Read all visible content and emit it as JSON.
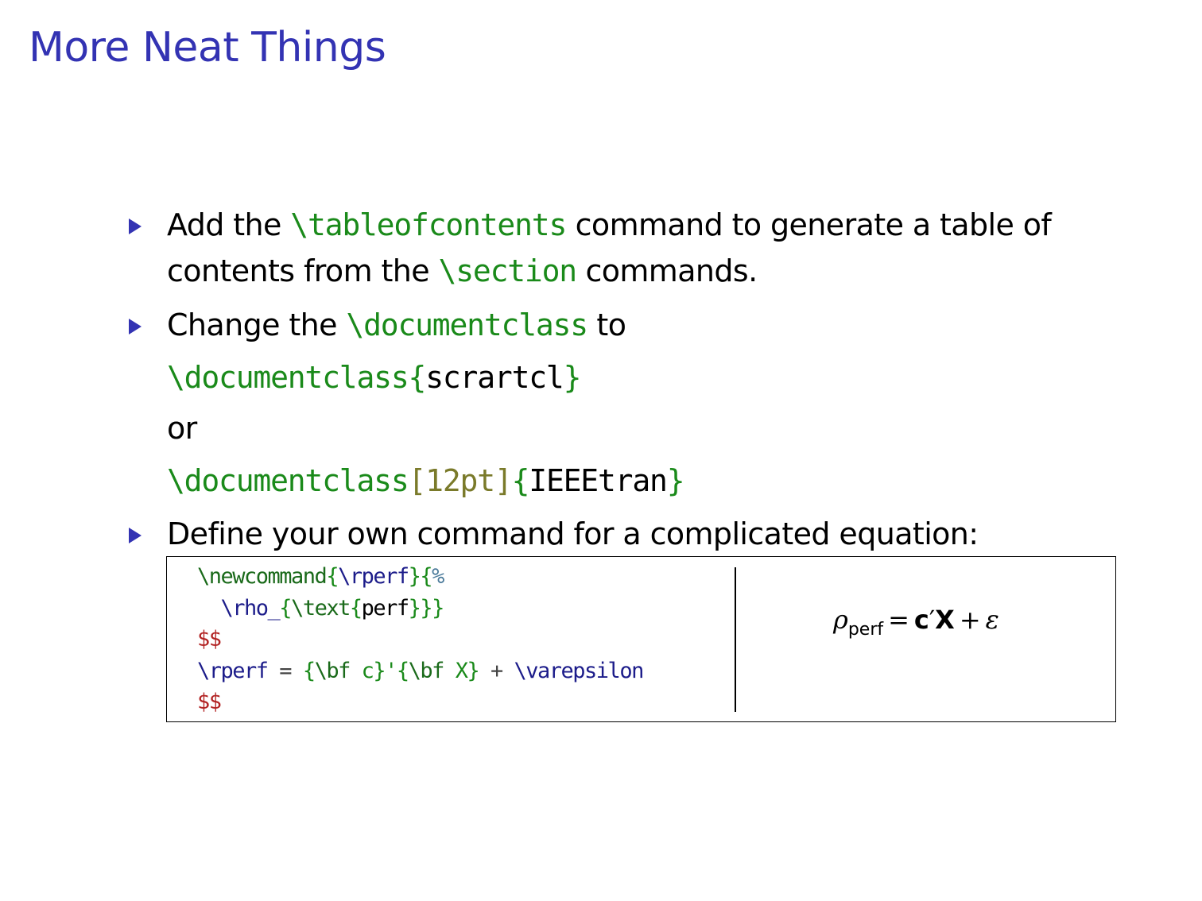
{
  "slide": {
    "title": "More Neat Things"
  },
  "bullets": {
    "b1": {
      "pre": "Add the ",
      "cmd1": "\\tableofcontents",
      "mid": " command to generate a table of",
      "line2_pre": "contents from the ",
      "cmd2": "\\section",
      "line2_post": " commands."
    },
    "b2": {
      "pre": "Change the ",
      "cmd": "\\documentclass",
      "post": " to",
      "ex1_cmd": "\\documentclass",
      "ex1_open": "{",
      "ex1_arg": "scrartcl",
      "ex1_close": "}",
      "or": "or",
      "ex2_cmd": "\\documentclass",
      "ex2_opt": "[12pt]",
      "ex2_open": "{",
      "ex2_arg": "IEEEtran",
      "ex2_close": "}"
    },
    "b3": {
      "text": "Define your own command for a complicated equation:"
    }
  },
  "code_box": {
    "line1": {
      "kw": "\\newcommand",
      "b1": "{",
      "cmd": "\\rperf",
      "b2": "}{",
      "comment": "%"
    },
    "line2": {
      "indent": "  ",
      "cmd": "\\rho_",
      "b1": "{",
      "kw": "\\text",
      "b2": "{",
      "arg": "perf",
      "b3": "}}}"
    },
    "line3": "$$",
    "line4": {
      "cmd": "\\rperf",
      "eq": " = ",
      "b1": "{",
      "bf1": "\\bf",
      "c": " c",
      "b2": "}'{",
      "bf2": "\\bf",
      "x": " X",
      "b3": "}",
      "plus": " + ",
      "eps": "\\varepsilon"
    },
    "line5": "$$"
  },
  "rendered_math": {
    "rho": "ρ",
    "sub": "perf",
    "equals": "=",
    "c": "c",
    "prime": "′",
    "X": "X",
    "plus": "+",
    "eps": "ε"
  }
}
